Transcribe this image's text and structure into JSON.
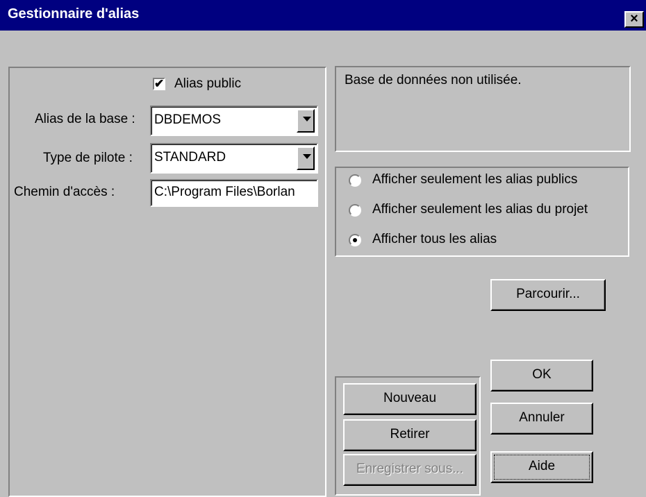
{
  "window": {
    "title": "Gestionnaire d'alias",
    "close_label": "×"
  },
  "left_panel": {
    "public_checkbox": {
      "label": "Alias public",
      "checked": true
    },
    "alias_field": {
      "label": "Alias de la base :",
      "value": "DBDEMOS"
    },
    "driver_field": {
      "label": "Type de pilote :",
      "value": "STANDARD"
    },
    "path_field": {
      "label": "Chemin d'accès :",
      "value": "C:\\Program Files\\Borlan"
    }
  },
  "status": {
    "text": "Base de données non utilisée."
  },
  "display_options": {
    "items": [
      {
        "label": "Afficher seulement les alias publics",
        "selected": false
      },
      {
        "label": "Afficher seulement les alias du projet",
        "selected": false
      },
      {
        "label": "Afficher tous les alias",
        "selected": true
      }
    ]
  },
  "buttons": {
    "browse": "Parcourir...",
    "new": "Nouveau",
    "remove": "Retirer",
    "save_as": "Enregistrer sous...",
    "ok": "OK",
    "cancel": "Annuler",
    "help": "Aide"
  }
}
